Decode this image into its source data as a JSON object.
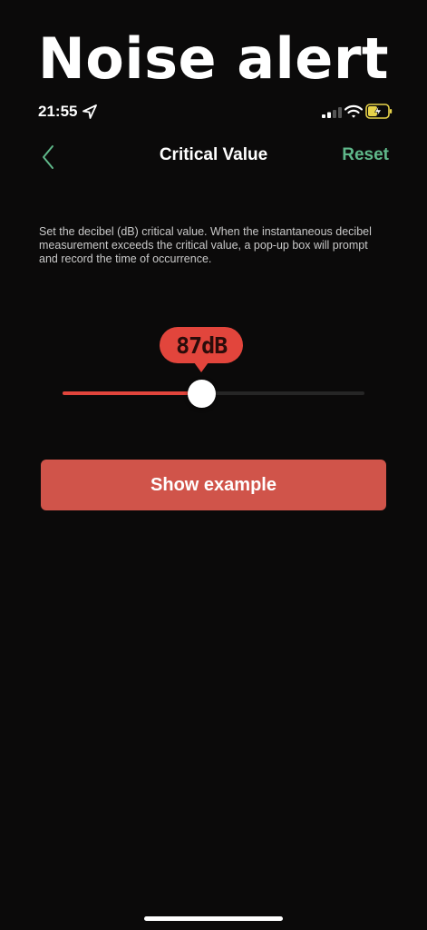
{
  "banner": {
    "title": "Noise alert"
  },
  "status_bar": {
    "time": "21:55",
    "icons": [
      "location-arrow-icon",
      "cellular-signal-icon",
      "wifi-icon",
      "battery-charging-icon"
    ]
  },
  "nav": {
    "back_icon": "chevron-left-icon",
    "title": "Critical Value",
    "reset_label": "Reset"
  },
  "description": "Set the decibel (dB) critical value. When the instantaneous decibel measurement exceeds the critical value, a pop-up box will prompt and record the time of occurrence.",
  "slider": {
    "value_label": "87dB",
    "value_fraction": 0.46
  },
  "show_example_label": "Show example",
  "colors": {
    "background": "#0b0a0a",
    "accent_red": "#e2453c",
    "button_red": "#d0544a",
    "accent_green": "#5fb88a"
  }
}
